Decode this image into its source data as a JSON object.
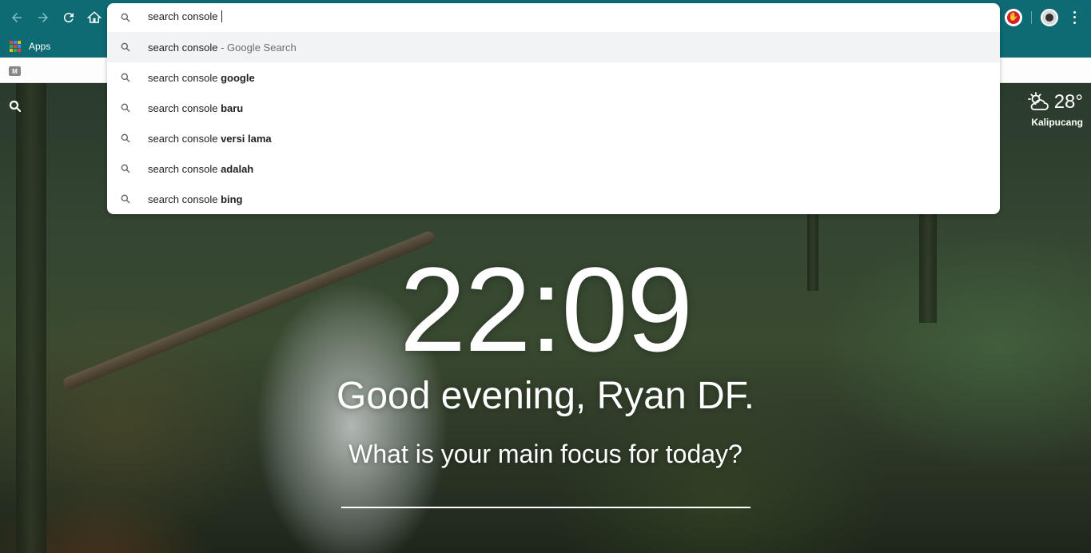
{
  "browser": {
    "bookmarks": {
      "apps_label": "Apps"
    },
    "omnibox": {
      "query": "search console",
      "suggestions": [
        {
          "prefix": "search console",
          "bold": "",
          "suffix": " - Google Search",
          "selected": true
        },
        {
          "prefix": "search console ",
          "bold": "google",
          "suffix": "",
          "selected": false
        },
        {
          "prefix": "search console ",
          "bold": "baru",
          "suffix": "",
          "selected": false
        },
        {
          "prefix": "search console ",
          "bold": "versi lama",
          "suffix": "",
          "selected": false
        },
        {
          "prefix": "search console ",
          "bold": "adalah",
          "suffix": "",
          "selected": false
        },
        {
          "prefix": "search console ",
          "bold": "bing",
          "suffix": "",
          "selected": false
        }
      ]
    },
    "second_bar": {
      "tab_icon_letter": "M"
    }
  },
  "momentum": {
    "weather": {
      "temperature": "28°",
      "location": "Kalipucang",
      "icon": "partly-cloudy-icon"
    },
    "clock": "22:09",
    "greeting": "Good evening, Ryan DF.",
    "focus_question": "What is your main focus for today?",
    "focus_input_value": ""
  },
  "colors": {
    "toolbar": "#0e6a73",
    "omnibox_bg": "#ffffff",
    "selected_row": "#f1f3f4",
    "text_primary": "#202124",
    "text_secondary": "#6a6e72"
  }
}
